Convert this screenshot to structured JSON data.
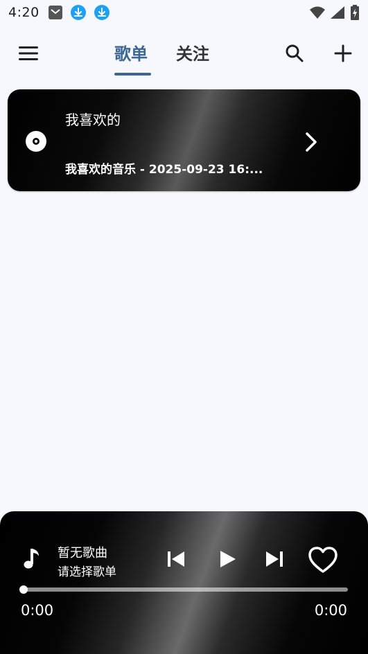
{
  "status_bar": {
    "time": "4:20",
    "icons": [
      "mail-icon",
      "download-icon",
      "download-icon",
      "wifi-icon",
      "signal-icon",
      "battery-icon"
    ]
  },
  "app_bar": {
    "tabs": [
      {
        "label": "歌单",
        "active": true
      },
      {
        "label": "关注",
        "active": false
      }
    ],
    "accent_color": "#3c6694"
  },
  "playlist_card": {
    "name": "我喜欢的",
    "subtitle": "我喜欢的音乐 - 2025-09-23 16:..."
  },
  "player": {
    "song_title": "暂无歌曲",
    "song_subtitle": "请选择歌单",
    "elapsed": "0:00",
    "total": "0:00",
    "progress": 0
  }
}
